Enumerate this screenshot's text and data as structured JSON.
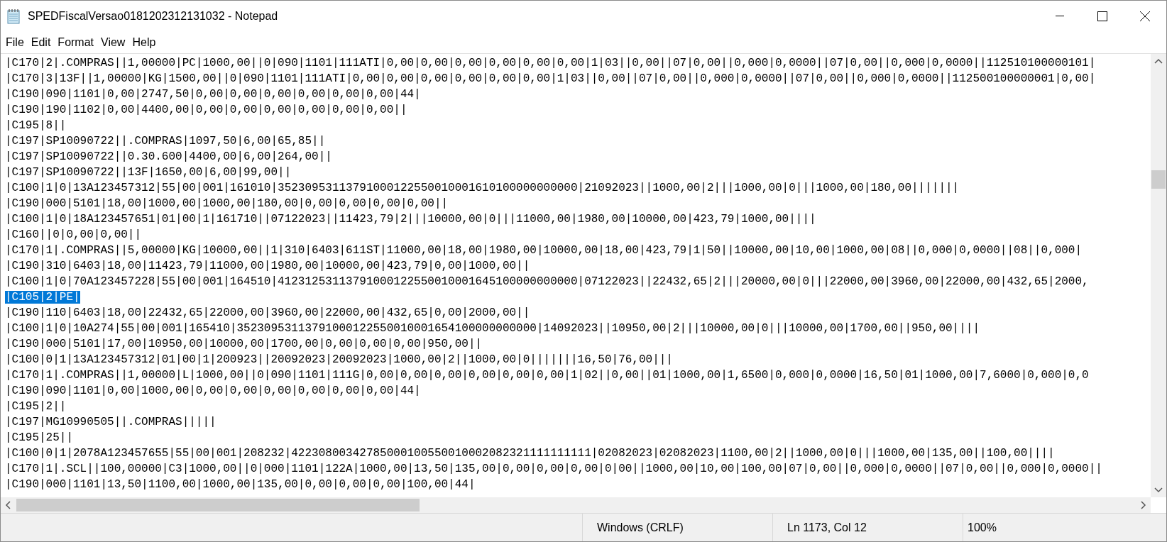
{
  "window": {
    "title": "SPEDFiscalVersao0181202312131032 - Notepad"
  },
  "menu": [
    "File",
    "Edit",
    "Format",
    "View",
    "Help"
  ],
  "lines": [
    {
      "text": "|C170|2|.COMPRAS||1,00000|PC|1000,00||0|090|1101|111ATI|0,00|0,00|0,00|0,00|0,00|0,00|1|03||0,00||07|0,00||0,000|0,0000||07|0,00||0,000|0,0000||112510100000101|",
      "selected": false
    },
    {
      "text": "|C170|3|13F||1,00000|KG|1500,00||0|090|1101|111ATI|0,00|0,00|0,00|0,00|0,00|0,00|1|03||0,00||07|0,00||0,000|0,0000||07|0,00||0,000|0,0000||112500100000001|0,00|",
      "selected": false
    },
    {
      "text": "|C190|090|1101|0,00|2747,50|0,00|0,00|0,00|0,00|0,00|0,00|44|",
      "selected": false
    },
    {
      "text": "|C190|190|1102|0,00|4400,00|0,00|0,00|0,00|0,00|0,00|0,00||",
      "selected": false
    },
    {
      "text": "|C195|8||",
      "selected": false
    },
    {
      "text": "|C197|SP10090722||.COMPRAS|1097,50|6,00|65,85||",
      "selected": false
    },
    {
      "text": "|C197|SP10090722||0.30.600|4400,00|6,00|264,00||",
      "selected": false
    },
    {
      "text": "|C197|SP10090722||13F|1650,00|6,00|99,00||",
      "selected": false
    },
    {
      "text": "|C100|1|0|13A123457312|55|00|001|161010|35230953113791000122550010001610100000000000|21092023||1000,00|2|||1000,00|0|||1000,00|180,00|||||||",
      "selected": false
    },
    {
      "text": "|C190|000|5101|18,00|1000,00|1000,00|180,00|0,00|0,00|0,00|0,00||",
      "selected": false
    },
    {
      "text": "|C100|1|0|18A123457651|01|00|1|161710||07122023||11423,79|2|||10000,00|0|||11000,00|1980,00|10000,00|423,79|1000,00||||",
      "selected": false
    },
    {
      "text": "|C160||0|0,00|0,00||",
      "selected": false
    },
    {
      "text": "|C170|1|.COMPRAS||5,00000|KG|10000,00||1|310|6403|611ST|11000,00|18,00|1980,00|10000,00|18,00|423,79|1|50||10000,00|10,00|1000,00|08||0,000|0,0000||08||0,000|",
      "selected": false
    },
    {
      "text": "|C190|310|6403|18,00|11423,79|11000,00|1980,00|10000,00|423,79|0,00|1000,00||",
      "selected": false
    },
    {
      "text": "|C100|1|0|70A123457228|55|00|001|164510|41231253113791000122550010001645100000000000|07122023||22432,65|2|||20000,00|0|||22000,00|3960,00|22000,00|432,65|2000,",
      "selected": false
    },
    {
      "text": "|C105|2|PE|",
      "selected": true
    },
    {
      "text": "|C190|110|6403|18,00|22432,65|22000,00|3960,00|22000,00|432,65|0,00|2000,00||",
      "selected": false
    },
    {
      "text": "|C100|1|0|10A274|55|00|001|165410|35230953113791000122550010001654100000000000|14092023||10950,00|2|||10000,00|0|||10000,00|1700,00||950,00||||",
      "selected": false
    },
    {
      "text": "|C190|000|5101|17,00|10950,00|10000,00|1700,00|0,00|0,00|0,00|950,00||",
      "selected": false
    },
    {
      "text": "|C100|0|1|13A123457312|01|00|1|200923||20092023|20092023|1000,00|2||1000,00|0|||||||16,50|76,00|||",
      "selected": false
    },
    {
      "text": "|C170|1|.COMPRAS||1,00000|L|1000,00||0|090|1101|111G|0,00|0,00|0,00|0,00|0,00|0,00|1|02||0,00||01|1000,00|1,6500|0,000|0,0000|16,50|01|1000,00|7,6000|0,000|0,0",
      "selected": false
    },
    {
      "text": "|C190|090|1101|0,00|1000,00|0,00|0,00|0,00|0,00|0,00|0,00|44|",
      "selected": false
    },
    {
      "text": "|C195|2||",
      "selected": false
    },
    {
      "text": "|C197|MG10990505||.COMPRAS|||||",
      "selected": false
    },
    {
      "text": "|C195|25||",
      "selected": false
    },
    {
      "text": "|C100|0|1|2078A123457655|55|00|001|208232|42230800342785000100550010002082321111111111|02082023|02082023|1100,00|2||1000,00|0|||1000,00|135,00||100,00||||",
      "selected": false
    },
    {
      "text": "|C170|1|.SCL||100,00000|C3|1000,00||0|000|1101|122A|1000,00|13,50|135,00|0,00|0,00|0,00|0|00||1000,00|10,00|100,00|07|0,00||0,000|0,0000||07|0,00||0,000|0,0000||",
      "selected": false
    },
    {
      "text": "|C190|000|1101|13,50|1100,00|1000,00|135,00|0,00|0,00|0,00|100,00|44|",
      "selected": false
    }
  ],
  "status_bar": [
    "Windows (CRLF)",
    "Ln 1173, Col 12",
    "100%"
  ]
}
